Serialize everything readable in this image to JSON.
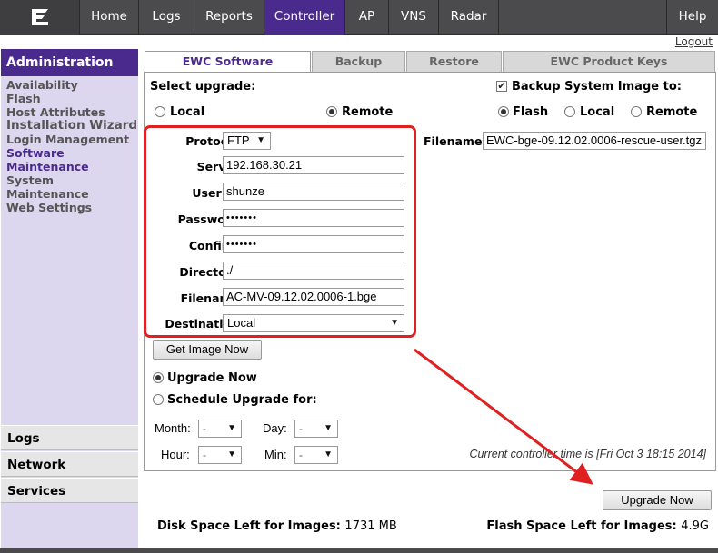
{
  "nav": {
    "tabs": [
      {
        "label": "Home"
      },
      {
        "label": "Logs"
      },
      {
        "label": "Reports"
      },
      {
        "label": "Controller"
      },
      {
        "label": "AP"
      },
      {
        "label": "VNS"
      },
      {
        "label": "Radar"
      },
      {
        "label": "Help"
      }
    ],
    "logout": "Logout",
    "accent": "#4a2a8c"
  },
  "sidebar": {
    "header": "Administration",
    "items": [
      "Availability",
      "Flash",
      "Host Attributes",
      "Installation Wizard",
      "Login Management",
      "Software Maintenance",
      "System Maintenance",
      "Web Settings"
    ],
    "sections": [
      "Logs",
      "Network",
      "Services"
    ]
  },
  "tabs": [
    "EWC Software",
    "Backup",
    "Restore",
    "EWC Product Keys"
  ],
  "upgrade": {
    "select_label": "Select upgrade:",
    "local": "Local",
    "remote": "Remote",
    "protocol_label": "Protocol:",
    "protocol": "FTP",
    "server_label": "Server:",
    "server": "192.168.30.21",
    "userid_label": "User ID:",
    "userid": "shunze",
    "password_label": "Password:",
    "password": "•••••••",
    "confirm_label": "Confirm:",
    "confirm": "•••••••",
    "directory_label": "Directory:",
    "directory": "./",
    "filename_label": "Filename:",
    "filename": "AC-MV-09.12.02.0006-1.bge",
    "destination_label": "Destination:",
    "destination": "Local",
    "get_image": "Get Image Now",
    "upgrade_now_option": "Upgrade Now",
    "schedule_option": "Schedule Upgrade for:",
    "month_label": "Month:",
    "day_label": "Day:",
    "hour_label": "Hour:",
    "min_label": "Min:",
    "dash": "-",
    "controller_time": "Current controller time is [Fri Oct 3 18:15 2014]"
  },
  "backup": {
    "label": "Backup System Image to:",
    "flash": "Flash",
    "local": "Local",
    "remote": "Remote",
    "filename_label": "Filename:",
    "filename": "EWC-bge-09.12.02.0006-rescue-user.tgz"
  },
  "actions": {
    "upgrade_now": "Upgrade Now"
  },
  "footer": {
    "disk_label": "Disk Space Left for Images:",
    "disk_value": "1731 MB",
    "flash_label": "Flash Space Left for Images:",
    "flash_value": "4.9G"
  }
}
